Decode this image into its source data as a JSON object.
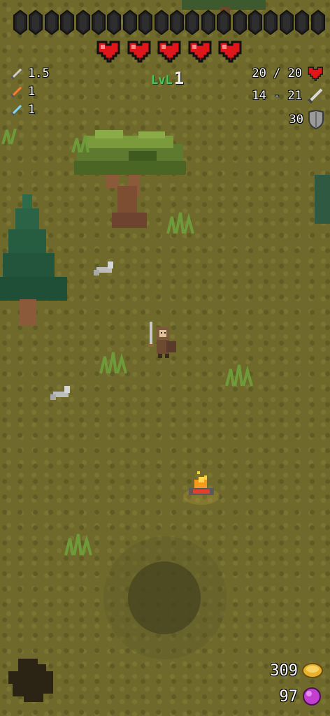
{
  "hud": {
    "xp_bar": {
      "segments": 20,
      "filled": 0
    },
    "hearts": {
      "count": 5,
      "full": 5,
      "color": "#e0161b"
    },
    "level": {
      "prefix": "LvL",
      "value": "1"
    },
    "left_stats": [
      {
        "icon": "sword-icon",
        "value": "1.5"
      },
      {
        "icon": "fire-sword-icon",
        "value": "1"
      },
      {
        "icon": "ice-sword-icon",
        "value": "1"
      }
    ],
    "health": {
      "text": "20 / 20",
      "icon": "heart-icon"
    },
    "damage": {
      "text": "14 - 21",
      "icon": "sword-icon"
    },
    "armor": {
      "text": "30",
      "icon": "shield-icon"
    },
    "gold": {
      "value": "309",
      "icon": "gold-coin-icon",
      "color": "#e8b12a"
    },
    "gems": {
      "value": "97",
      "icon": "purple-gem-icon",
      "color": "#c23fd0"
    }
  },
  "colors": {
    "grass": "#6f6a2c",
    "hud_level": "#47c95a"
  }
}
